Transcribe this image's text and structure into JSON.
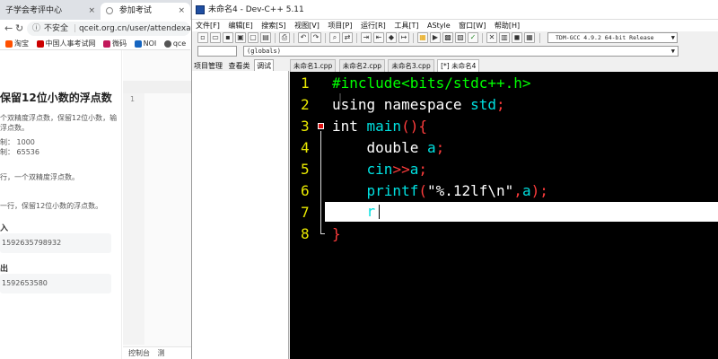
{
  "browser": {
    "tabs": [
      {
        "label": "子学会考评中心",
        "close": "×"
      },
      {
        "label": "参加考试",
        "close": "×"
      }
    ],
    "address": {
      "security": "不安全",
      "url": "qceit.org.cn/user/attendexam.html?i"
    },
    "bookmarks": [
      "淘宝",
      "中国人事考试网",
      "微码",
      "NOI",
      "qce"
    ]
  },
  "problem": {
    "title": "保留12位小数的浮点数",
    "desc_lines": [
      "个双精度浮点数，保留12位小数，输",
      "浮点数。"
    ],
    "time_limit": "制： 1000",
    "mem_limit": "制： 65536",
    "input_desc": "行，一个双精度浮点数。",
    "output_desc": "一行，保留12位小数的浮点数。",
    "input_label": "入",
    "input_sample": "1592635798932",
    "output_label": "出",
    "output_sample": "1592653580"
  },
  "mid_editor": {
    "line_number": "1",
    "bottom_tabs": [
      "控制台",
      "测"
    ]
  },
  "ide": {
    "title": "未命名4 - Dev-C++ 5.11",
    "menu": [
      "文件[F]",
      "编辑[E]",
      "搜索[S]",
      "视图[V]",
      "项目[P]",
      "运行[R]",
      "工具[T]",
      "AStyle",
      "窗口[W]",
      "帮助[H]"
    ],
    "compiler": "TDM-GCC 4.9.2 64-bit Release",
    "scope": "(globals)",
    "left_tabs": [
      "项目管理",
      "查看类",
      "调试"
    ],
    "file_tabs": [
      "未命名1.cpp",
      "未命名2.cpp",
      "未命名3.cpp",
      "[*] 未命名4"
    ],
    "code_lines": {
      "l1": {
        "n": "1",
        "a": "#include<bits/stdc++.h>"
      },
      "l2": {
        "n": "2",
        "kw": "using namespace ",
        "id": "std",
        "p": ";"
      },
      "l3": {
        "n": "3",
        "kw": "int ",
        "id": "main",
        "p1": "(",
        "p2": ")",
        "p3": "{"
      },
      "l4": {
        "n": "4",
        "ind": "    ",
        "kw": "double ",
        "id": "a",
        "p": ";"
      },
      "l5": {
        "n": "5",
        "ind": "    ",
        "id": "cin",
        "op": ">>",
        "id2": "a",
        "p": ";"
      },
      "l6": {
        "n": "6",
        "ind": "    ",
        "id": "printf",
        "p1": "(",
        "s": "\"%.12lf\\n\"",
        "c": ",",
        "id2": "a",
        "p2": ")",
        "p3": ";"
      },
      "l7": {
        "n": "7",
        "ind": "    ",
        "id": "r"
      },
      "l8": {
        "n": "8",
        "p": "}"
      }
    }
  },
  "colors": {
    "editor_bg": "#000000",
    "line_number": "#e8e800",
    "identifier": "#00e0e0",
    "keyword": "#ffffff",
    "preprocessor": "#00ff00",
    "symbol": "#ff3c3c"
  }
}
